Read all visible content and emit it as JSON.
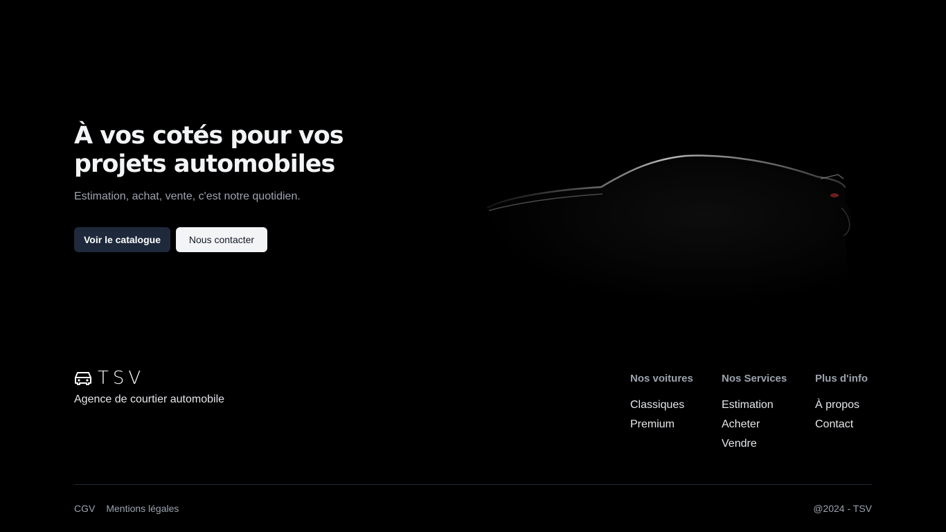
{
  "hero": {
    "title": "À vos cotés pour vos projets automobiles",
    "subtitle": "Estimation, achat, vente, c'est notre quotidien.",
    "primary_button": "Voir le catalogue",
    "secondary_button": "Nous contacter"
  },
  "footer": {
    "logo_text": "TSV",
    "tagline": "Agence de courtier automobile",
    "columns": [
      {
        "heading": "Nos voitures",
        "links": [
          "Classiques",
          "Premium"
        ]
      },
      {
        "heading": "Nos Services",
        "links": [
          "Estimation",
          "Acheter",
          "Vendre"
        ]
      },
      {
        "heading": "Plus d'info",
        "links": [
          "À propos",
          "Contact"
        ]
      }
    ],
    "legal_links": [
      "CGV",
      "Mentions légales"
    ],
    "copyright": "@2024 - TSV"
  },
  "colors": {
    "background": "#000000",
    "primary_button_bg": "#1e293b",
    "secondary_button_bg": "#f3f4f6",
    "muted_text": "#9ca3af"
  }
}
